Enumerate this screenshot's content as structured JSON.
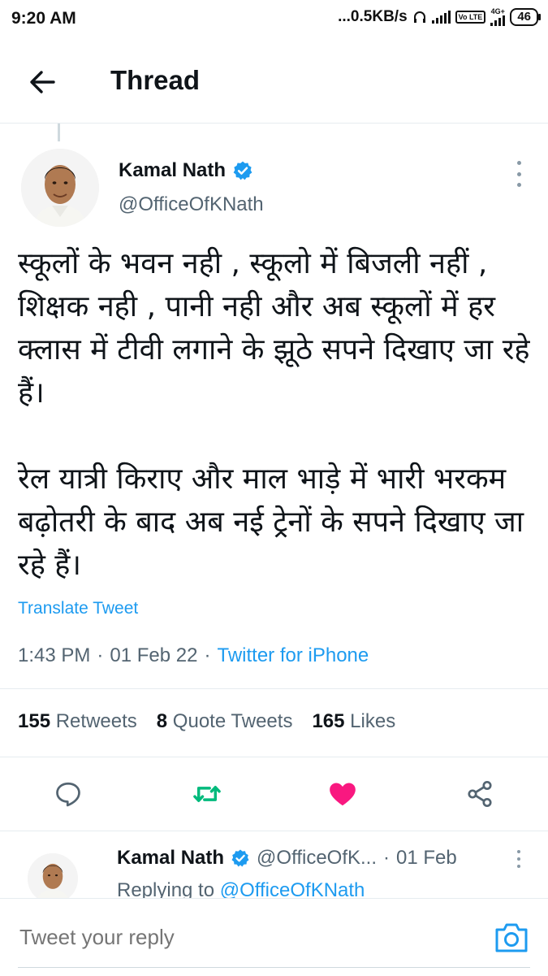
{
  "status_bar": {
    "time": "9:20 AM",
    "net_speed": "...0.5KB/s",
    "lte_label": "Vo LTE",
    "net_type": "4G+",
    "battery": "46"
  },
  "header": {
    "title": "Thread"
  },
  "tweet": {
    "author_name": "Kamal Nath",
    "author_handle": "@OfficeOfKNath",
    "paragraph_1": "स्कूलों के भवन नही , स्कूलो में बिजली नहीं , शिक्षक नही , पानी नही और अब स्कूलों में हर क्लास में टीवी लगाने के झूठे सपने दिखाए जा रहे हैं।",
    "paragraph_2": "रेल यात्री किराए और माल भाड़े में भारी भरकम बढ़ोतरी के बाद अब नई ट्रेनों के सपने दिखाए जा रहे हैं।",
    "translate_label": "Translate Tweet",
    "time": "1:43 PM",
    "separator": "·",
    "date": "01 Feb 22",
    "source": "Twitter for iPhone",
    "retweets_count": "155",
    "retweets_label": "Retweets",
    "quotes_count": "8",
    "quotes_label": "Quote Tweets",
    "likes_count": "165",
    "likes_label": "Likes",
    "liked": true
  },
  "reply_preview": {
    "author_name": "Kamal Nath",
    "author_handle": "@OfficeOfK...",
    "separator": "·",
    "date": "01 Feb",
    "replying_prefix": "Replying to",
    "replying_to": "@OfficeOfKNath"
  },
  "composer": {
    "placeholder": "Tweet your reply"
  },
  "colors": {
    "accent": "#1d9bf0",
    "like": "#f91880",
    "retweet": "#00ba7c",
    "muted": "#536471"
  },
  "icons": [
    "back-arrow-icon",
    "verified-badge-icon",
    "more-options-icon",
    "reply-icon",
    "retweet-icon",
    "like-heart-icon",
    "share-icon",
    "camera-icon"
  ]
}
